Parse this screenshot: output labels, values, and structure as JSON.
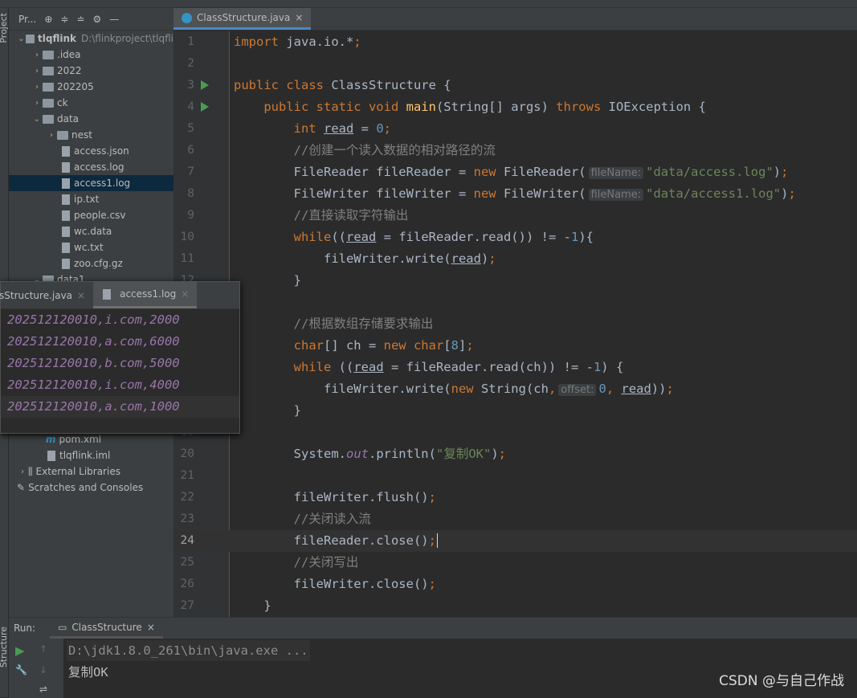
{
  "project": {
    "title": "Pr...",
    "root": "tlqflink",
    "root_path": "D:\\flinkproject\\tlqfli",
    "items": [
      {
        "label": ".idea",
        "type": "folder",
        "indent": 1,
        "arrow": "right"
      },
      {
        "label": "2022",
        "type": "folder",
        "indent": 1,
        "arrow": "right"
      },
      {
        "label": "202205",
        "type": "folder",
        "indent": 1,
        "arrow": "right"
      },
      {
        "label": "ck",
        "type": "folder",
        "indent": 1,
        "arrow": "right"
      },
      {
        "label": "data",
        "type": "folder",
        "indent": 1,
        "arrow": "down"
      },
      {
        "label": "nest",
        "type": "folder",
        "indent": 2,
        "arrow": "right"
      },
      {
        "label": "access.json",
        "type": "file",
        "indent": 3
      },
      {
        "label": "access.log",
        "type": "file",
        "indent": 3
      },
      {
        "label": "access1.log",
        "type": "file",
        "indent": 3,
        "selected": true
      },
      {
        "label": "ip.txt",
        "type": "file",
        "indent": 3
      },
      {
        "label": "people.csv",
        "type": "file",
        "indent": 3
      },
      {
        "label": "wc.data",
        "type": "file",
        "indent": 3
      },
      {
        "label": "wc.txt",
        "type": "file",
        "indent": 3
      },
      {
        "label": "zoo.cfg.gz",
        "type": "file",
        "indent": 3
      },
      {
        "label": "data1",
        "type": "folder",
        "indent": 1,
        "arrow": "down"
      }
    ],
    "lower_items": [
      {
        "label": "pom.xml",
        "type": "maven",
        "indent": 2
      },
      {
        "label": "tlqflink.iml",
        "type": "file",
        "indent": 2
      },
      {
        "label": "External Libraries",
        "type": "lib",
        "indent": 0,
        "arrow": "right"
      },
      {
        "label": "Scratches and Consoles",
        "type": "scratch",
        "indent": 0
      }
    ]
  },
  "side_labels": {
    "project": "Project",
    "structure": "Structure"
  },
  "editor": {
    "tab": "ClassStructure.java",
    "current_line": 24,
    "lines": [
      [
        [
          "k",
          "import "
        ],
        [
          "t",
          "java.io.*"
        ],
        [
          "k",
          ";"
        ]
      ],
      [],
      [
        [
          "k",
          "public class "
        ],
        [
          "t",
          "ClassStructure {"
        ]
      ],
      [
        [
          "t",
          "    "
        ],
        [
          "k",
          "public static void "
        ],
        [
          "m",
          "main"
        ],
        [
          "t",
          "(String[] args) "
        ],
        [
          "k",
          "throws "
        ],
        [
          "t",
          "IOException {"
        ]
      ],
      [
        [
          "t",
          "        "
        ],
        [
          "k",
          "int "
        ],
        [
          "u",
          "read"
        ],
        [
          "t",
          " = "
        ],
        [
          "n",
          "0"
        ],
        [
          "k",
          ";"
        ]
      ],
      [
        [
          "t",
          "        "
        ],
        [
          "c",
          "//创建一个读入数据的相对路径的流"
        ]
      ],
      [
        [
          "t",
          "        FileReader fileReader = "
        ],
        [
          "k",
          "new "
        ],
        [
          "t",
          "FileReader("
        ],
        [
          "h",
          "fileName:"
        ],
        [
          "s",
          "\"data/access.log\""
        ],
        [
          "t",
          ")"
        ],
        [
          "k",
          ";"
        ]
      ],
      [
        [
          "t",
          "        FileWriter fileWriter = "
        ],
        [
          "k",
          "new "
        ],
        [
          "t",
          "FileWriter("
        ],
        [
          "h",
          "fileName:"
        ],
        [
          "s",
          "\"data/access1.log\""
        ],
        [
          "t",
          ")"
        ],
        [
          "k",
          ";"
        ]
      ],
      [
        [
          "t",
          "        "
        ],
        [
          "c",
          "//直接读取字符输出"
        ]
      ],
      [
        [
          "t",
          "        "
        ],
        [
          "k",
          "while"
        ],
        [
          "t",
          "(("
        ],
        [
          "u",
          "read"
        ],
        [
          "t",
          " = fileReader.read()) != -"
        ],
        [
          "n",
          "1"
        ],
        [
          "t",
          "){"
        ]
      ],
      [
        [
          "t",
          "            fileWriter.write("
        ],
        [
          "u",
          "read"
        ],
        [
          "t",
          ")"
        ],
        [
          "k",
          ";"
        ]
      ],
      [
        [
          "t",
          "        }"
        ]
      ],
      [],
      [
        [
          "t",
          "        "
        ],
        [
          "c",
          "//根据数组存储要求输出"
        ]
      ],
      [
        [
          "t",
          "        "
        ],
        [
          "k",
          "char"
        ],
        [
          "t",
          "[] ch = "
        ],
        [
          "k",
          "new char"
        ],
        [
          "t",
          "["
        ],
        [
          "n",
          "8"
        ],
        [
          "t",
          "]"
        ],
        [
          "k",
          ";"
        ]
      ],
      [
        [
          "t",
          "        "
        ],
        [
          "k",
          "while "
        ],
        [
          "t",
          "(("
        ],
        [
          "u",
          "read"
        ],
        [
          "t",
          " = fileReader.read(ch)) != -"
        ],
        [
          "n",
          "1"
        ],
        [
          "t",
          ") {"
        ]
      ],
      [
        [
          "t",
          "            fileWriter.write("
        ],
        [
          "k",
          "new "
        ],
        [
          "t",
          "String(ch"
        ],
        [
          "k",
          ","
        ],
        [
          "h",
          "offset:"
        ],
        [
          "n",
          "0"
        ],
        [
          "k",
          ", "
        ],
        [
          "u",
          "read"
        ],
        [
          "t",
          "))"
        ],
        [
          "k",
          ";"
        ]
      ],
      [
        [
          "t",
          "        }"
        ]
      ],
      [],
      [
        [
          "t",
          "        System."
        ],
        [
          "o",
          "out"
        ],
        [
          "t",
          ".println("
        ],
        [
          "s",
          "\"复制OK\""
        ],
        [
          "t",
          ")"
        ],
        [
          "k",
          ";"
        ]
      ],
      [],
      [
        [
          "t",
          "        fileWriter.flush()"
        ],
        [
          "k",
          ";"
        ]
      ],
      [
        [
          "t",
          "        "
        ],
        [
          "c",
          "//关闭读入流"
        ]
      ],
      [
        [
          "t",
          "        fileReader.close()"
        ],
        [
          "k",
          ";"
        ]
      ],
      [
        [
          "t",
          "        "
        ],
        [
          "c",
          "//关闭写出"
        ]
      ],
      [
        [
          "t",
          "        fileWriter.close()"
        ],
        [
          "k",
          ";"
        ]
      ],
      [
        [
          "t",
          "    }"
        ]
      ]
    ],
    "run_lines": [
      3,
      4
    ]
  },
  "popup": {
    "tabs": [
      {
        "label": "sStructure.java"
      },
      {
        "label": "access1.log",
        "active": true
      }
    ],
    "lines": [
      "202512120010,i.com,2000",
      "202512120010,a.com,6000",
      "202512120010,b.com,5000",
      "202512120010,i.com,4000",
      "202512120010,a.com,1000"
    ],
    "current_line": 5
  },
  "run": {
    "label": "Run:",
    "tab": "ClassStructure",
    "output": [
      "D:\\jdk1.8.0_261\\bin\\java.exe ...",
      "复制OK"
    ]
  },
  "watermark": "CSDN @与自己作战",
  "colors": {
    "keyword": "#cc7832",
    "string": "#6a8759",
    "comment": "#808080",
    "number": "#6897bb",
    "selection": "#0d293e",
    "accent": "#4a88c7"
  }
}
